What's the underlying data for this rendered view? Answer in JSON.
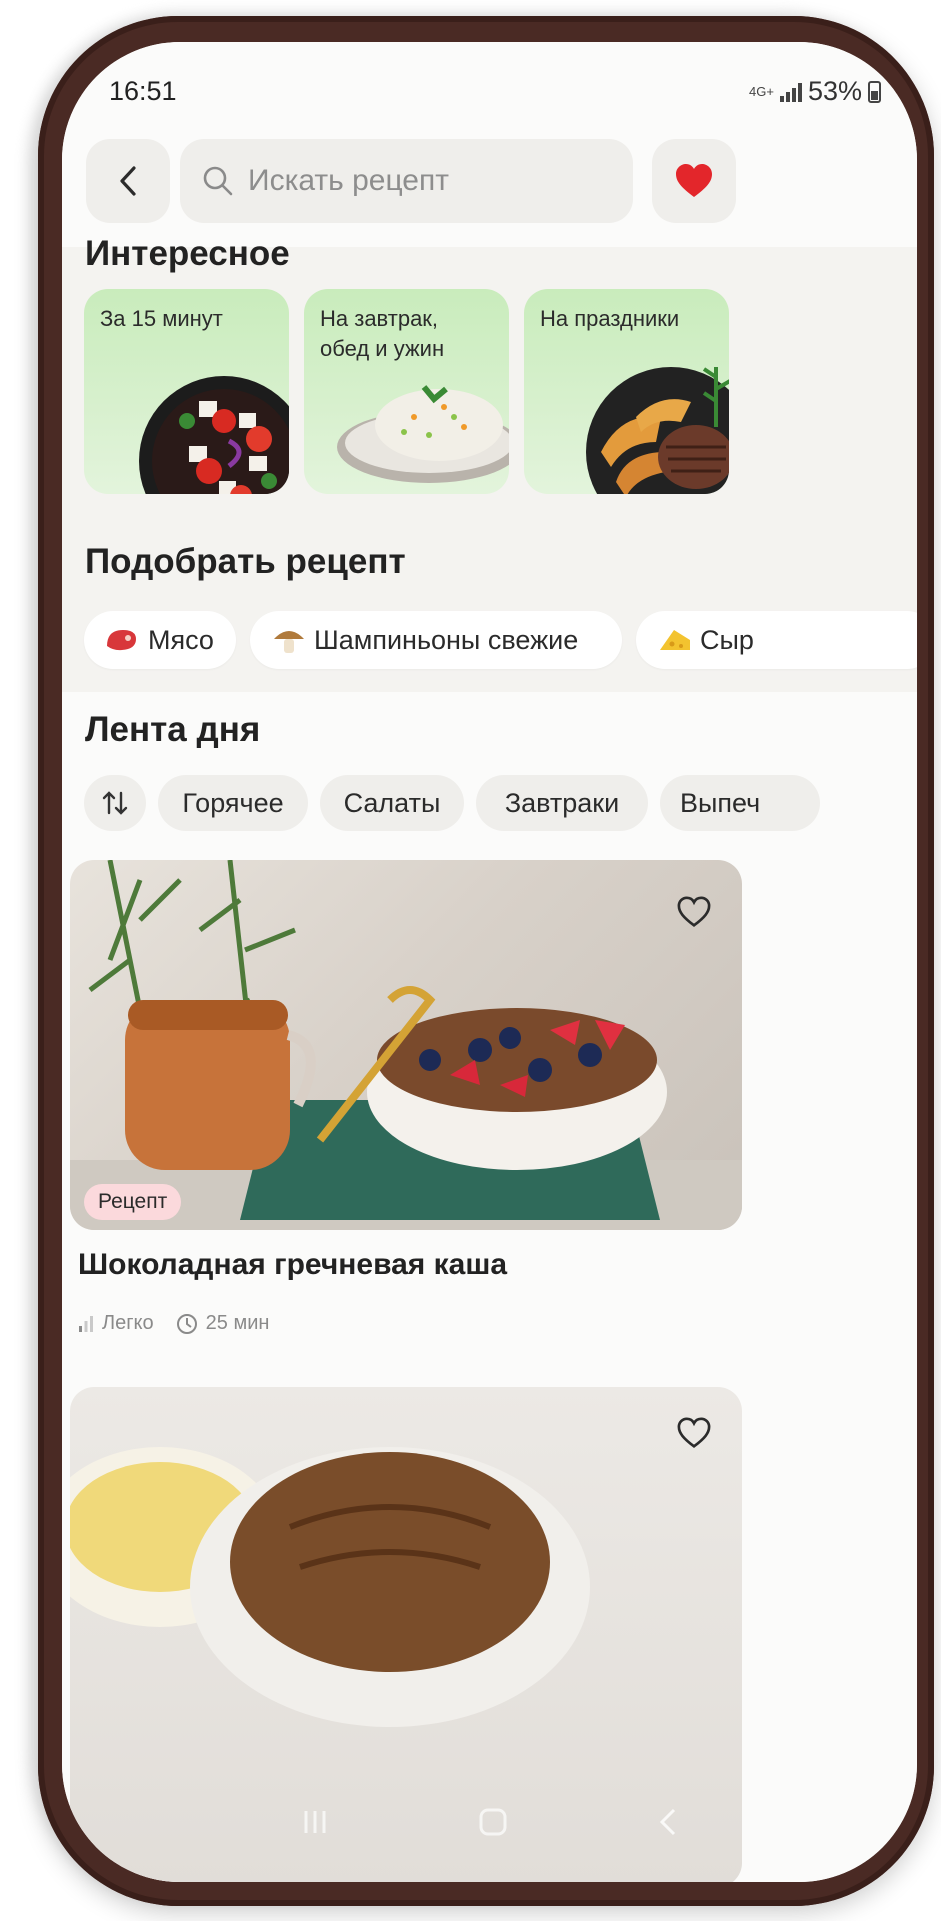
{
  "status_bar": {
    "time": "16:51",
    "network": "4G+",
    "battery": "53%"
  },
  "header": {
    "search_placeholder": "Искать рецепт"
  },
  "interesting": {
    "title": "Интересное",
    "cards": [
      {
        "label": "За 15 минут"
      },
      {
        "label_line1": "На завтрак,",
        "label_line2": "обед и ужин"
      },
      {
        "label": "На праздники"
      }
    ]
  },
  "pick_recipe": {
    "title": "Подобрать рецепт",
    "chips": [
      {
        "label": "Мясо",
        "icon": "meat-icon"
      },
      {
        "label": "Шампиньоны свежие",
        "icon": "mushroom-icon"
      },
      {
        "label": "Сыр",
        "icon": "cheese-icon"
      }
    ]
  },
  "feed": {
    "title": "Лента дня",
    "filters": [
      "Горячее",
      "Салаты",
      "Завтраки",
      "Выпеч"
    ],
    "recipe": {
      "tag": "Рецепт",
      "title": "Шоколадная гречневая каша",
      "difficulty": "Легко",
      "time": "25 мин"
    }
  },
  "colors": {
    "accent_red": "#e3262b",
    "card_green": "#cdebbf",
    "tag_pink": "#fbd9dc"
  }
}
